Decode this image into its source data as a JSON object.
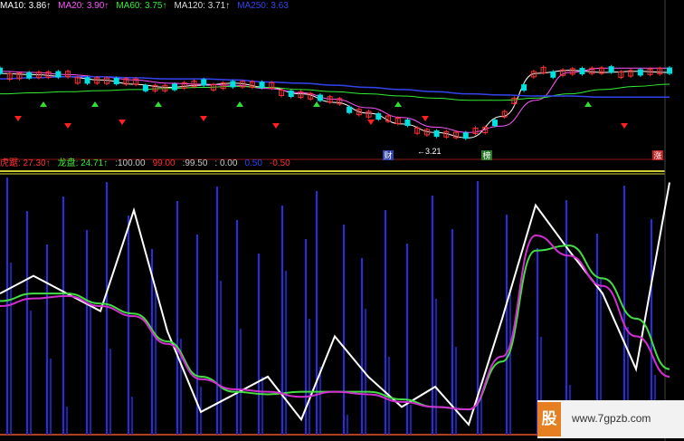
{
  "top_legend": [
    {
      "label": "MA10",
      "value": "3.86",
      "arrow": "↑",
      "color": "#ffffff"
    },
    {
      "label": "MA20",
      "value": "3.90",
      "arrow": "↑",
      "color": "#ff55ff"
    },
    {
      "label": "MA60",
      "value": "3.75",
      "arrow": "↑",
      "color": "#33ee33"
    },
    {
      "label": "MA120",
      "value": "3.71",
      "arrow": "↑",
      "color": "#dddddd"
    },
    {
      "label": "MA250",
      "value": "3.63",
      "arrow": "",
      "color": "#3344ee"
    }
  ],
  "indicator_legend": [
    {
      "label": "虎踞",
      "value": "27.30",
      "arrow": "↑",
      "color": "#ff3030"
    },
    {
      "label": "龙盘",
      "value": "24.71",
      "arrow": "↑",
      "color": "#33ee33"
    },
    {
      "label": "",
      "value": ":100.00",
      "arrow": "",
      "color": "#c8c8c8"
    },
    {
      "label": "",
      "value": "99.00",
      "arrow": "",
      "color": "#ff3030"
    },
    {
      "label": "",
      "value": ":99.50",
      "arrow": "",
      "color": "#c8c8c8"
    },
    {
      "label": "",
      "value": ": 0.00",
      "arrow": "",
      "color": "#c8c8c8"
    },
    {
      "label": "",
      "value": "0.50",
      "arrow": "",
      "color": "#3344ee"
    },
    {
      "label": "",
      "value": "-0.50",
      "arrow": "",
      "color": "#ff3030"
    }
  ],
  "markers": {
    "cai": "财",
    "bang": "榜",
    "price_low": "3.21",
    "zhang": "涨"
  },
  "watermark": {
    "logo": "股",
    "url": "www.7gpzb.com"
  },
  "colors": {
    "background": "#000000",
    "up_candle": "#ff3030",
    "down_candle": "#00e0e0",
    "ma_white": "#ffffff",
    "ma_magenta": "#ff55ff",
    "ma_green": "#33ee33",
    "ma_blue": "#3344ee",
    "ind_white": "#ffffff",
    "ind_magenta": "#d030d0",
    "ind_green": "#44dd44",
    "ind_blue": "#2a2ae8",
    "level_yellow": "#cccc33"
  },
  "chart_data": [
    {
      "type": "line",
      "panel": "price",
      "x": [
        0,
        10,
        20,
        30,
        40,
        50,
        60,
        70,
        80,
        90,
        100,
        110,
        120,
        130,
        140,
        150,
        160,
        170,
        180,
        190,
        200
      ],
      "ylim": [
        3.1,
        4.4
      ],
      "series": [
        {
          "name": "MA10",
          "values": [
            3.85,
            3.84,
            3.82,
            3.79,
            3.75,
            3.72,
            3.74,
            3.76,
            3.72,
            3.66,
            3.58,
            3.48,
            3.38,
            3.3,
            3.25,
            3.45,
            3.85,
            3.88,
            3.86,
            3.87,
            3.86
          ]
        },
        {
          "name": "MA20",
          "values": [
            3.87,
            3.86,
            3.84,
            3.82,
            3.79,
            3.76,
            3.75,
            3.74,
            3.71,
            3.67,
            3.61,
            3.53,
            3.44,
            3.35,
            3.3,
            3.36,
            3.6,
            3.86,
            3.9,
            3.9,
            3.9
          ]
        },
        {
          "name": "MA60",
          "values": [
            3.66,
            3.67,
            3.68,
            3.69,
            3.7,
            3.71,
            3.72,
            3.73,
            3.72,
            3.7,
            3.68,
            3.66,
            3.64,
            3.62,
            3.6,
            3.6,
            3.62,
            3.66,
            3.7,
            3.73,
            3.75
          ]
        },
        {
          "name": "MA250",
          "values": [
            3.8,
            3.81,
            3.82,
            3.82,
            3.81,
            3.8,
            3.8,
            3.79,
            3.77,
            3.76,
            3.74,
            3.72,
            3.7,
            3.68,
            3.66,
            3.65,
            3.64,
            3.64,
            3.63,
            3.63,
            3.63
          ]
        }
      ]
    },
    {
      "type": "line",
      "panel": "indicator",
      "x": [
        0,
        10,
        20,
        30,
        40,
        50,
        60,
        70,
        80,
        90,
        100,
        110,
        120,
        130,
        140,
        150,
        160,
        170,
        180,
        190,
        200
      ],
      "ylim": [
        -1,
        101
      ],
      "series": [
        {
          "name": "虎踞",
          "values": [
            55,
            62,
            55,
            48,
            88,
            40,
            8,
            15,
            22,
            5,
            38,
            22,
            10,
            18,
            3,
            45,
            90,
            72,
            55,
            25,
            99
          ]
        },
        {
          "name": "龙盘",
          "values": [
            52,
            55,
            55,
            51,
            47,
            36,
            22,
            16,
            15,
            16,
            16,
            16,
            13,
            10,
            9,
            28,
            72,
            74,
            61,
            45,
            25
          ]
        },
        {
          "name": "",
          "values": [
            50,
            53,
            54,
            50,
            46,
            35,
            21,
            17,
            16,
            14,
            16,
            15,
            12,
            10,
            9,
            30,
            78,
            70,
            58,
            38,
            22
          ]
        }
      ]
    }
  ]
}
